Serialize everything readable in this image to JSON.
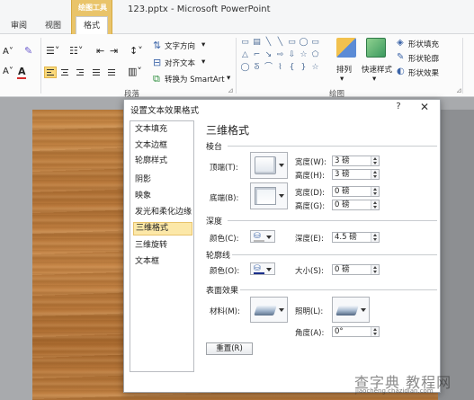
{
  "app": {
    "context_group": "绘图工具",
    "tabs": [
      "审阅",
      "视图",
      "格式"
    ],
    "active_tab": "格式",
    "document_title": "123.pptx - Microsoft PowerPoint"
  },
  "ribbon": {
    "paragraph": {
      "text_direction": "文字方向",
      "align_text": "对齐文本",
      "convert_smartart": "转换为 SmartArt",
      "group_label": "段落"
    },
    "drawing": {
      "arrange": "排列",
      "quick_styles": "快速样式",
      "shape_fill": "形状填充",
      "shape_outline": "形状轮廓",
      "shape_effects": "形状效果",
      "group_label": "绘图"
    }
  },
  "dialog": {
    "title": "设置文本效果格式",
    "help": "?",
    "close": "✕",
    "nav": [
      "文本填充",
      "文本边框",
      "轮廓样式",
      "阴影",
      "映象",
      "发光和柔化边缘",
      "三维格式",
      "三维旋转",
      "文本框"
    ],
    "selected_nav": "三维格式",
    "panel": {
      "section_title": "三维格式",
      "bevel": {
        "title": "棱台",
        "top_label": "顶端(T):",
        "bottom_label": "底端(B):",
        "top_width_label": "宽度(W):",
        "top_width": "3 磅",
        "top_height_label": "高度(H):",
        "top_height": "3 磅",
        "bottom_width_label": "宽度(D):",
        "bottom_width": "0 磅",
        "bottom_height_label": "高度(G):",
        "bottom_height": "0 磅"
      },
      "depth": {
        "title": "深度",
        "color_label": "颜色(C):",
        "depth_label": "深度(E):",
        "depth_value": "4.5 磅"
      },
      "contour": {
        "title": "轮廓线",
        "color_label": "颜色(O):",
        "size_label": "大小(S):",
        "size_value": "0 磅"
      },
      "surface": {
        "title": "表面效果",
        "material_label": "材料(M):",
        "lighting_label": "照明(L):",
        "angle_label": "角度(A):",
        "angle_value": "0°"
      },
      "reset": "重置(R)"
    }
  },
  "watermark": {
    "text": "查字典 教程网",
    "url": "jiaocheng.chazidian.com"
  },
  "colors": {
    "context_tab": "#e9c46a",
    "selection": "#fce8a8",
    "wood": "#c08042"
  }
}
